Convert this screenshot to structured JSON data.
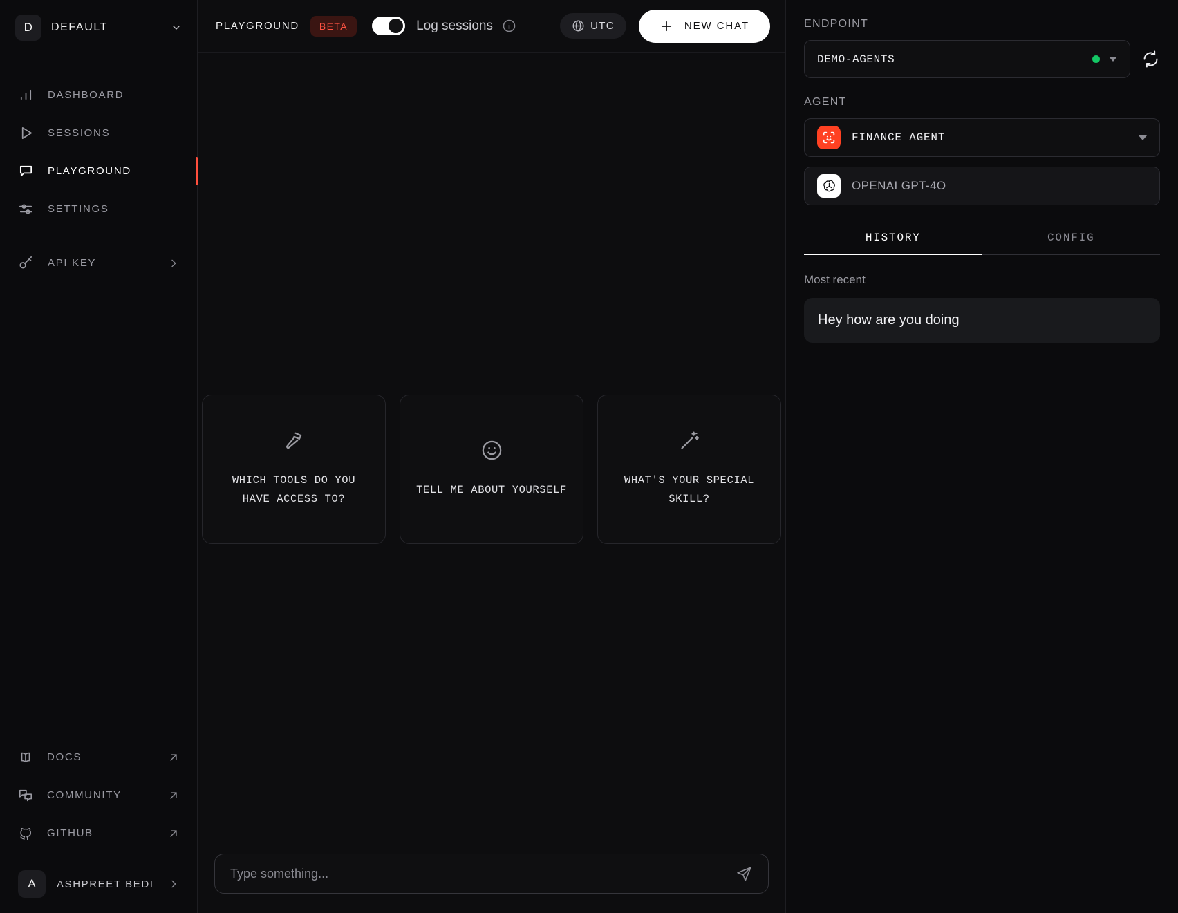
{
  "sidebar": {
    "workspace": {
      "avatar_letter": "D",
      "name": "DEFAULT",
      "chevron_icon": "chevron-down-icon"
    },
    "nav": [
      {
        "label": "DASHBOARD",
        "icon": "bar-chart-icon",
        "active": false
      },
      {
        "label": "SESSIONS",
        "icon": "play-triangle-icon",
        "active": false
      },
      {
        "label": "PLAYGROUND",
        "icon": "chat-bubble-icon",
        "active": true
      },
      {
        "label": "SETTINGS",
        "icon": "sliders-icon",
        "active": false
      }
    ],
    "api_key": {
      "label": "API KEY",
      "icon": "key-icon",
      "chevron_icon": "chevron-right-icon"
    },
    "footer_links": [
      {
        "label": "DOCS",
        "icon": "book-icon",
        "external_icon": "arrow-up-right-icon"
      },
      {
        "label": "COMMUNITY",
        "icon": "comments-icon",
        "external_icon": "arrow-up-right-icon"
      },
      {
        "label": "GITHUB",
        "icon": "github-icon",
        "external_icon": "arrow-up-right-icon"
      }
    ],
    "user": {
      "avatar_letter": "A",
      "name": "ASHPREET BEDI",
      "chevron_icon": "chevron-right-icon"
    }
  },
  "topbar": {
    "title": "PLAYGROUND",
    "badge": "BETA",
    "log_sessions_label": "Log sessions",
    "log_sessions_enabled": true,
    "info_icon": "info-circle-icon",
    "timezone": {
      "label": "UTC",
      "icon": "globe-icon"
    },
    "new_chat": {
      "label": "NEW CHAT",
      "icon": "plus-icon"
    }
  },
  "main": {
    "suggestion_cards": [
      {
        "icon": "hammer-icon",
        "text": "WHICH TOOLS DO YOU HAVE ACCESS TO?"
      },
      {
        "icon": "smiley-face-icon",
        "text": "TELL ME ABOUT YOURSELF"
      },
      {
        "icon": "magic-wand-icon",
        "text": "WHAT'S YOUR SPECIAL SKILL?"
      }
    ],
    "composer": {
      "placeholder": "Type something...",
      "value": "",
      "send_icon": "send-paper-plane-icon"
    }
  },
  "right_panel": {
    "endpoint_label": "ENDPOINT",
    "endpoint_value": "DEMO-AGENTS",
    "endpoint_status_color": "#14c765",
    "refresh_icon": "refresh-icon",
    "agent_label": "AGENT",
    "agent_value": "FINANCE AGENT",
    "agent_logo_icon": "scan-face-icon",
    "agent_logo_color": "#ff4122",
    "model_value": "OPENAI GPT-4O",
    "model_logo_icon": "openai-icon",
    "tabs": [
      {
        "label": "HISTORY",
        "active": true
      },
      {
        "label": "CONFIG",
        "active": false
      }
    ],
    "history": {
      "section_label": "Most recent",
      "items": [
        {
          "text": "Hey how are you doing"
        }
      ]
    }
  },
  "colors": {
    "accent_red": "#ff4f3d",
    "beta_red": "#ff5443",
    "status_green": "#14c765",
    "background": "#0d0d0f",
    "panel": "#0b0b0d"
  }
}
